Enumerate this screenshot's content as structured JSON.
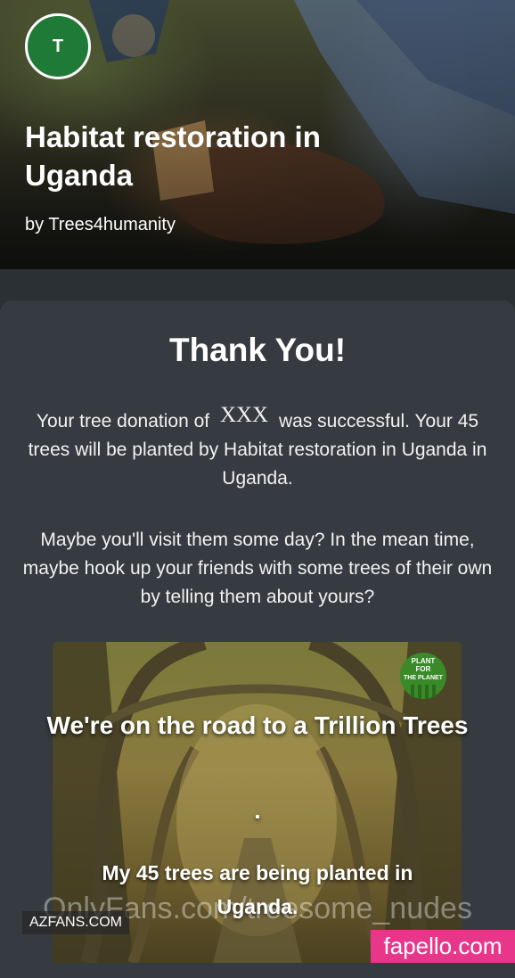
{
  "project": {
    "avatar_letter": "T",
    "title": "Habitat restoration in Uganda",
    "byline": "by Trees4humanity"
  },
  "confirmation": {
    "heading": "Thank You!",
    "p1_before": "Your tree donation of",
    "amount_redacted": "XXX",
    "p1_after": "was successful. Your 45 trees will be planted by Habitat restoration in Uganda in Uganda.",
    "p2": "Maybe you'll visit them some day? In the mean time, maybe hook up your friends with some trees of their own by telling them about yours?"
  },
  "share_card": {
    "headline": "We're on the road to a Trillion Trees",
    "separator": ".",
    "subline": "My 45 trees are being planted in Uganda.",
    "logo_text": "PLANT FOR THE PLANET"
  },
  "watermarks": {
    "overlay": "OnlyFans.com/treesome_nudes",
    "azfans": "AZFANS.COM",
    "fapello": "fapello.com"
  },
  "colors": {
    "page_bg": "#2b3034",
    "card_bg": "#353b40",
    "avatar_green": "#1f7a37",
    "fapello_pink": "#e8378b"
  }
}
